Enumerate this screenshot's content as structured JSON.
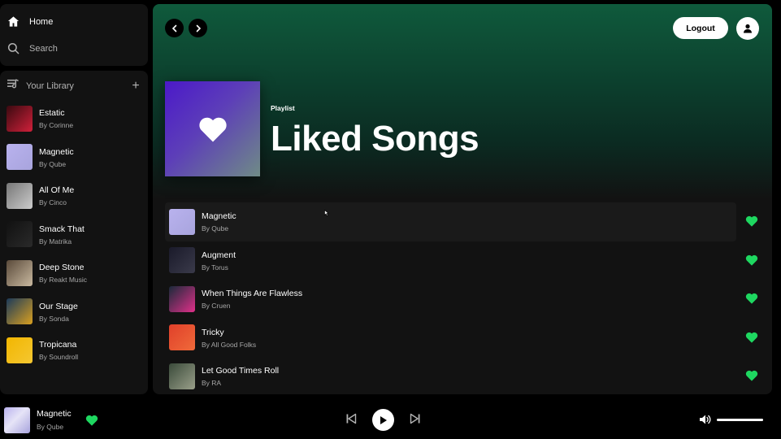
{
  "nav": {
    "home": {
      "label": "Home",
      "icon": "home-icon"
    },
    "search": {
      "label": "Search",
      "icon": "search-icon"
    }
  },
  "library": {
    "title": "Your Library",
    "items": [
      {
        "title": "Estatic",
        "subtitle": "By Corinne",
        "art": [
          "#3a0a10",
          "#d0203a"
        ]
      },
      {
        "title": "Magnetic",
        "subtitle": "By Qube",
        "art": [
          "#b9b2ee",
          "#a8a4dd"
        ]
      },
      {
        "title": "All Of Me",
        "subtitle": "By Cinco",
        "art": [
          "#777",
          "#ccc"
        ]
      },
      {
        "title": "Smack That",
        "subtitle": "By Matrika",
        "art": [
          "#111",
          "#2a2a2a"
        ]
      },
      {
        "title": "Deep Stone",
        "subtitle": "By Reakt Music",
        "art": [
          "#5a4a3a",
          "#c9b9a0"
        ]
      },
      {
        "title": "Our Stage",
        "subtitle": "By Sonda",
        "art": [
          "#1b3a5a",
          "#d9a020"
        ]
      },
      {
        "title": "Tropicana",
        "subtitle": "By Soundroll",
        "art": [
          "#f2b600",
          "#f5c731"
        ]
      }
    ]
  },
  "header": {
    "logout_label": "Logout"
  },
  "playlist": {
    "type": "Playlist",
    "title": "Liked Songs",
    "tracks": [
      {
        "title": "Magnetic",
        "subtitle": "By Qube",
        "art": [
          "#b9b2ee",
          "#a8a4dd"
        ],
        "liked": true
      },
      {
        "title": "Augment",
        "subtitle": "By Torus",
        "art": [
          "#1a1a2a",
          "#3a3a4a"
        ],
        "liked": true
      },
      {
        "title": "When Things Are Flawless",
        "subtitle": "By Cruen",
        "art": [
          "#1a2a3a",
          "#e0308a"
        ],
        "liked": true
      },
      {
        "title": "Tricky",
        "subtitle": "By All Good Folks",
        "art": [
          "#e0402a",
          "#f06a3a"
        ],
        "liked": true
      },
      {
        "title": "Let Good Times Roll",
        "subtitle": "By RA",
        "art": [
          "#3a4a3a",
          "#9aa08a"
        ],
        "liked": true
      }
    ]
  },
  "player": {
    "title": "Magnetic",
    "artist": "By Qube",
    "liked": true,
    "volume": 1.0
  },
  "colors": {
    "accent": "#1ed760",
    "background": "#121212",
    "muted": "#a7a7a7"
  }
}
